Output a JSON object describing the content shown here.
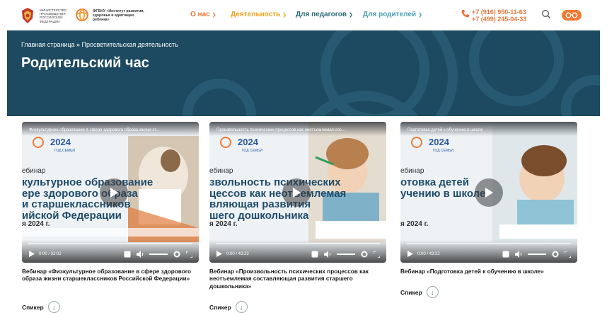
{
  "header": {
    "ministry_text": "Министерство просвещения Российской Федерации",
    "institute_text": "ФГБНУ «Институт развития, здоровья и адаптации ребенка»",
    "nav": [
      {
        "label": "О нас",
        "color": "#e8753b"
      },
      {
        "label": "Деятельность",
        "color": "#f0a21b"
      },
      {
        "label": "Для педагогов",
        "color": "#2d6b7a"
      },
      {
        "label": "Для родителей",
        "color": "#4aa0b0"
      }
    ],
    "phone_1": "+7 (916) 950-11-63",
    "phone_2": "+7 (499) 245-04-33",
    "search_icon": "search-icon",
    "accessibility_icon": "glasses-icon",
    "accent_color": "#f07a34"
  },
  "hero": {
    "breadcrumb": "Главная страница » Просветительская деятельность",
    "title": "Родительский час",
    "background_color": "#1d4a60"
  },
  "cards": [
    {
      "video_top_title": "Физкультурное образование в сфере здорового образа жизни ст...",
      "year_badge": "2024",
      "year_sub": "ГОД СЕМЬИ",
      "label": "ебинар",
      "title_lines": "культурное образование\nере здорового образа\nи старшеклассников\nийской Федерации",
      "date": "я 2024 г.",
      "time": "0:00 / 32:02",
      "title": "Вебинар «Физкультурное образование в сфере здорового образа жизни старшеклассников Российской Федерации»",
      "speaker": "Спикер"
    },
    {
      "video_top_title": "Произвольность психических процессов как неотъемлемая сос...",
      "year_badge": "2024",
      "year_sub": "ГОД СЕМЬИ",
      "label": "ебинар",
      "title_lines": "звольность психических\nцессов как неотъемлемая\nвляющая развития\nшего дошкольника",
      "date": "я 2024 г.",
      "time": "0:00 / 43:23",
      "title": "Вебинар «Произвольность психических процессов как неотъемлемая составляющая развития старшего дошкольника»",
      "speaker": "Спикер"
    },
    {
      "video_top_title": "Подготовка детей к обучению в школе",
      "year_badge": "2024",
      "year_sub": "ГОД СЕМЬИ",
      "label": "ебинар",
      "title_lines": "отовка детей\nучению в школе",
      "date": "я 2024 г.",
      "time": "0:00 / 43:32",
      "title": "Вебинар «Подготовка детей к обучению в школе»",
      "speaker": "Спикер"
    }
  ]
}
